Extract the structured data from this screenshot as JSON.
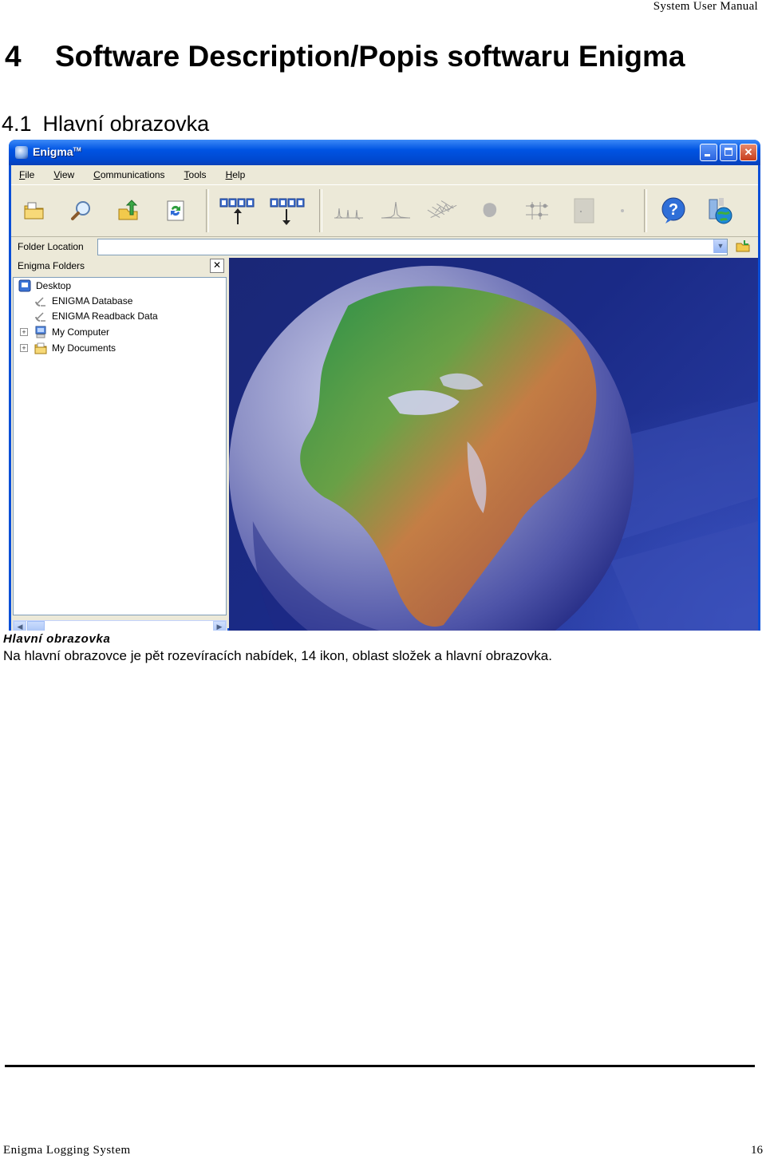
{
  "document": {
    "running_header": "System User Manual",
    "heading": {
      "number": "4",
      "title": "Software Description/Popis softwaru Enigma"
    },
    "subheading": {
      "number": "4.1",
      "title": "Hlavní obrazovka"
    },
    "caption": {
      "title": "Hlavní obrazovka",
      "text": "Na hlavní obrazovce je pět rozevíracích nabídek, 14 ikon, oblast složek a hlavní obrazovka."
    },
    "footer": {
      "left": "Enigma Logging System",
      "page_number": "16"
    }
  },
  "screenshot": {
    "window_title": "Enigma",
    "window_title_mark": "TM",
    "menu": [
      "File",
      "View",
      "Communications",
      "Tools",
      "Help"
    ],
    "toolbar_icons": [
      "open-folder-icon",
      "search-icon",
      "upload-icon",
      "refresh-icon",
      "upload-to-logger-icon",
      "download-from-logger-icon",
      "chart-peaks-icon",
      "chart-peak-icon",
      "chart-3d-icon",
      "blob-icon",
      "tree-diagram-icon",
      "page-icon",
      "help-icon",
      "network-globe-icon"
    ],
    "folder_location": {
      "label": "Folder Location",
      "value": ""
    },
    "folders_pane": {
      "title": "Enigma Folders",
      "close_glyph": "✕",
      "tree": [
        {
          "label": "Desktop",
          "icon": "desktop-icon",
          "expandable": false
        },
        {
          "label": "ENIGMA Database",
          "icon": "satellite-dish-icon",
          "expandable": false
        },
        {
          "label": "ENIGMA Readback Data",
          "icon": "satellite-dish-icon",
          "expandable": false
        },
        {
          "label": "My Computer",
          "icon": "computer-icon",
          "expandable": true
        },
        {
          "label": "My Documents",
          "icon": "documents-folder-icon",
          "expandable": true
        }
      ]
    },
    "colors": {
      "titlebar_blue": "#0054e3",
      "window_face": "#ece9d8",
      "main_background": "#1a2776",
      "close_red": "#c73c1b"
    }
  }
}
